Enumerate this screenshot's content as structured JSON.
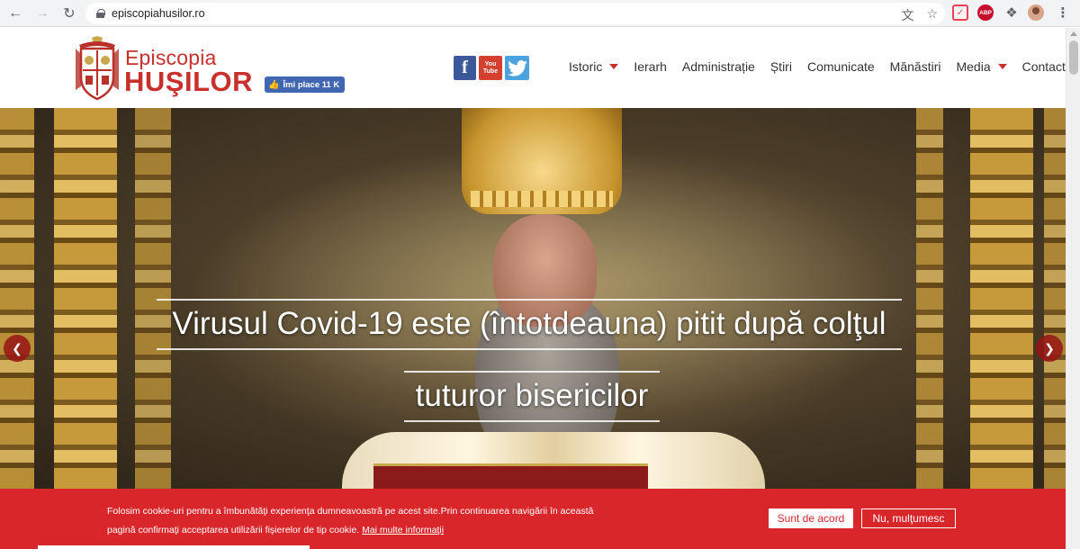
{
  "browser": {
    "url": "episcopiahusilor.ro"
  },
  "header": {
    "logo_line1": "Episcopia",
    "logo_line2": "HUŞILOR",
    "fb_like_label": "Îmi place 11 K"
  },
  "social": {
    "facebook": "f",
    "youtube_line1": "You",
    "youtube_line2": "Tube"
  },
  "nav": {
    "items": [
      {
        "label": "Istoric",
        "has_dropdown": true
      },
      {
        "label": "Ierarh",
        "has_dropdown": false
      },
      {
        "label": "Administrație",
        "has_dropdown": false
      },
      {
        "label": "Știri",
        "has_dropdown": false
      },
      {
        "label": "Comunicate",
        "has_dropdown": false
      },
      {
        "label": "Mănăstiri",
        "has_dropdown": false
      },
      {
        "label": "Media",
        "has_dropdown": true
      },
      {
        "label": "Contact",
        "has_dropdown": false
      }
    ]
  },
  "hero": {
    "headline_line1": "Virusul Covid-19 este (întotdeauna) pitit după colţul",
    "headline_line2": "tuturor bisericilor"
  },
  "cookie": {
    "text_line1": "Folosim cookie-uri pentru a îmbunătăţi experienţa dumneavoastră pe acest site.Prin continuarea navigării în această",
    "text_line2": "pagină confirmaţi acceptarea utilizării fişierelor de tip cookie.",
    "more_info": "Mai multe informaţii",
    "accept": "Sunt de acord",
    "decline": "Nu, mulţumesc"
  },
  "colors": {
    "brand_red": "#c9302c",
    "cookie_bg": "#d9262a",
    "facebook": "#3b5998",
    "youtube": "#d3402f",
    "twitter": "#4aa3df"
  }
}
